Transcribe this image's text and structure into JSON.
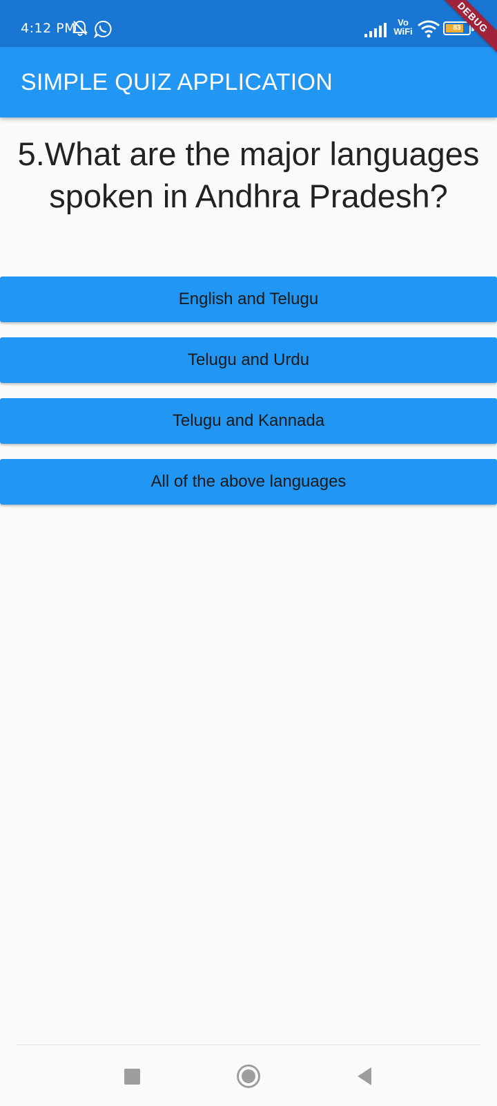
{
  "status_bar": {
    "time": "4:12 PM",
    "icons": [
      "bell-off-icon",
      "whatsapp-icon",
      "signal-icon",
      "vowifi-icon",
      "wifi-icon",
      "battery-icon"
    ],
    "vowifi_top": "Vo",
    "vowifi_bottom": "WiFi",
    "battery_level": "83",
    "background": "#1976d2"
  },
  "debug_banner": "DEBUG",
  "app_bar": {
    "title": "SIMPLE QUIZ APPLICATION",
    "background": "#2196f3"
  },
  "quiz": {
    "question": "5.What are the major languages spoken in Andhra Pradesh?",
    "answers": [
      "English and Telugu",
      "Telugu and Urdu",
      "Telugu and Kannada",
      "All of the above languages"
    ],
    "button_color": "#2196f3"
  },
  "nav_bar": {
    "icons": [
      "recents-square-icon",
      "home-circle-icon",
      "back-triangle-icon"
    ]
  }
}
